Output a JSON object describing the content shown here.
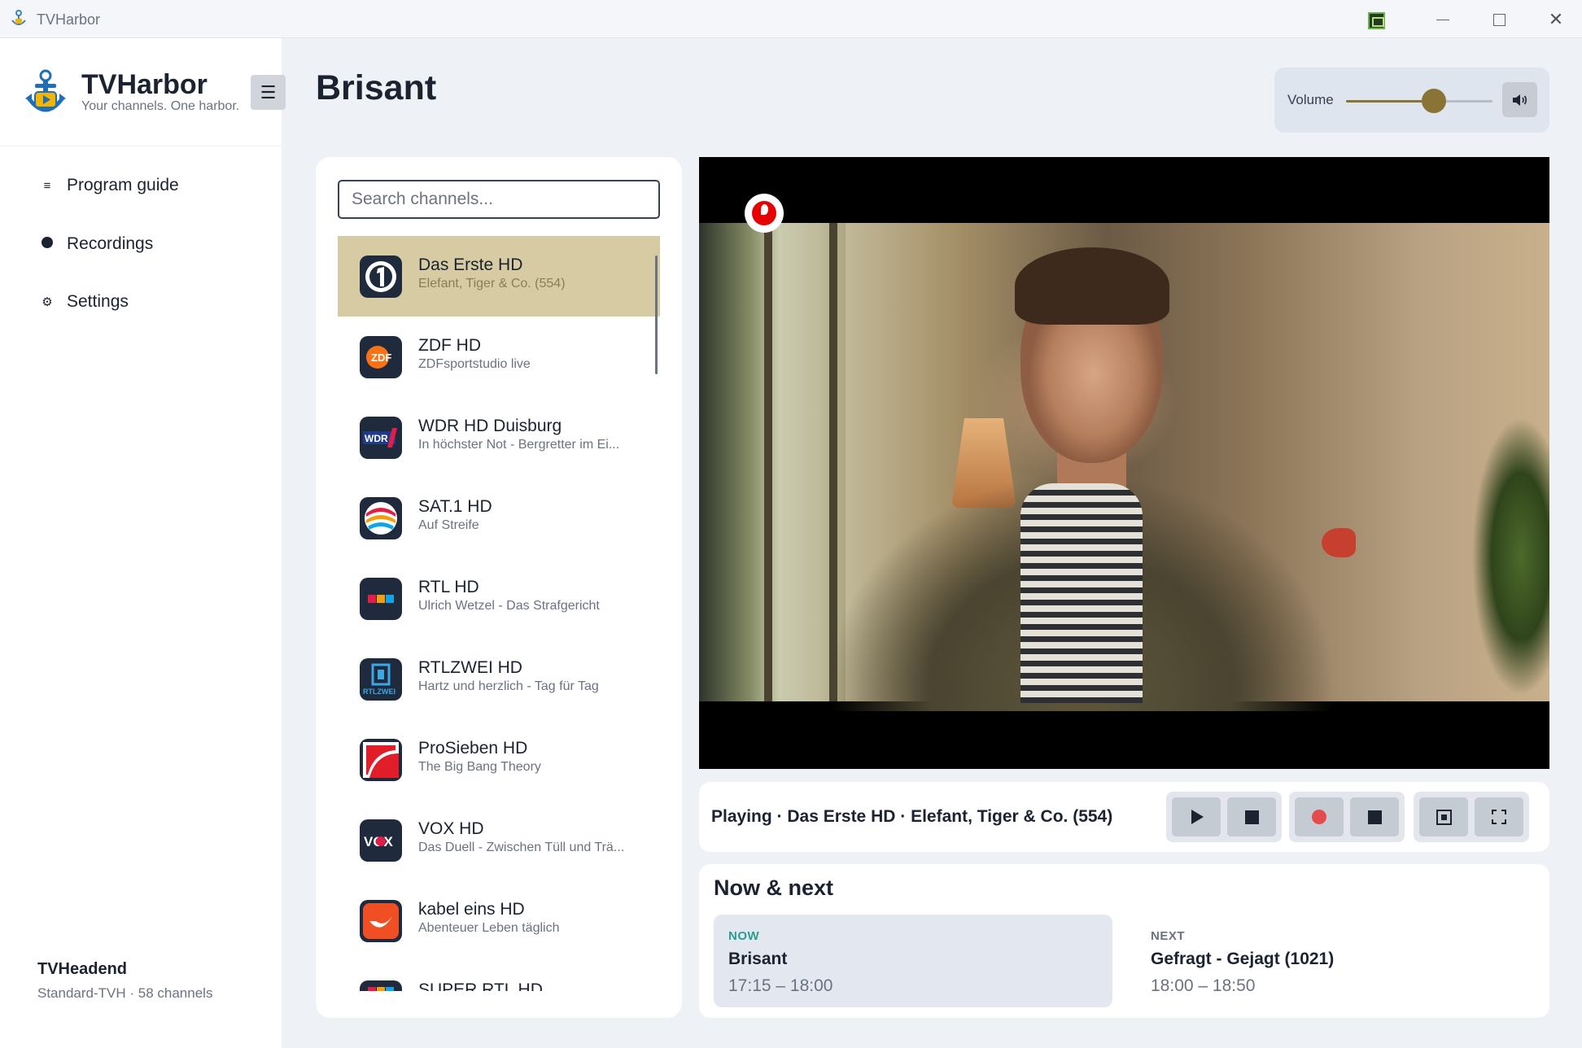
{
  "window": {
    "title": "TVHarbor",
    "tray_icon": "monitor-tray-icon"
  },
  "sidebar": {
    "brand_name": "TVHarbor",
    "brand_tagline": "Your channels. One harbor.",
    "menu_toggle": "☰",
    "nav": [
      {
        "label": "Program guide",
        "icon": "≡"
      },
      {
        "label": "Recordings",
        "icon": "record-dot-icon"
      },
      {
        "label": "Settings",
        "icon": "⚙"
      }
    ],
    "server_name": "TVHeadend",
    "server_info": "Standard-TVH · 58 channels"
  },
  "header": {
    "title": "Brisant",
    "volume_label": "Volume",
    "volume_level": 0.6
  },
  "search": {
    "placeholder": "Search channels..."
  },
  "channels": [
    {
      "name": "Das Erste HD",
      "program": "Elefant, Tiger & Co. (554)",
      "logo": "das-erste-logo",
      "active": true
    },
    {
      "name": "ZDF HD",
      "program": "ZDFsportstudio live",
      "logo": "zdf-logo",
      "active": false
    },
    {
      "name": "WDR HD Duisburg",
      "program": "In höchster Not - Bergretter im Ei...",
      "logo": "wdr-logo",
      "active": false
    },
    {
      "name": "SAT.1 HD",
      "program": "Auf Streife",
      "logo": "sat1-logo",
      "active": false
    },
    {
      "name": "RTL HD",
      "program": "Ulrich Wetzel - Das Strafgericht",
      "logo": "rtl-logo",
      "active": false
    },
    {
      "name": "RTLZWEI HD",
      "program": "Hartz und herzlich - Tag für Tag",
      "logo": "rtlzwei-logo",
      "active": false
    },
    {
      "name": "ProSieben HD",
      "program": "The Big Bang Theory",
      "logo": "prosieben-logo",
      "active": false
    },
    {
      "name": "VOX HD",
      "program": "Das Duell - Zwischen Tüll und Trä...",
      "logo": "vox-logo",
      "active": false
    },
    {
      "name": "kabel eins HD",
      "program": "Abenteuer Leben täglich",
      "logo": "kabel-eins-logo",
      "active": false
    },
    {
      "name": "SUPER RTL HD",
      "program": "",
      "logo": "super-rtl-logo",
      "active": false
    }
  ],
  "logo_text": {
    "zdf": "ZDF",
    "wdr": "WDR",
    "rtl": "RTL",
    "rtlzwei": "RTLZWEI",
    "vox": "VOX"
  },
  "player": {
    "status": "Playing · Das Erste HD · Elefant, Tiger & Co. (554)",
    "controls": [
      "play-icon",
      "stop-icon",
      "record-icon",
      "stop-recording-icon",
      "picture-in-picture-icon",
      "fullscreen-icon"
    ]
  },
  "now_next": {
    "title": "Now & next",
    "now": {
      "tag": "NOW",
      "show": "Brisant",
      "time": "17:15 – 18:00"
    },
    "next": {
      "tag": "NEXT",
      "show": "Gefragt - Gejagt (1021)",
      "time": "18:00 – 18:50"
    }
  },
  "colors": {
    "accent": "#8a7435",
    "active_row": "#d6cba3",
    "now_tag": "#2a9d8f",
    "record": "#e44b4b"
  }
}
